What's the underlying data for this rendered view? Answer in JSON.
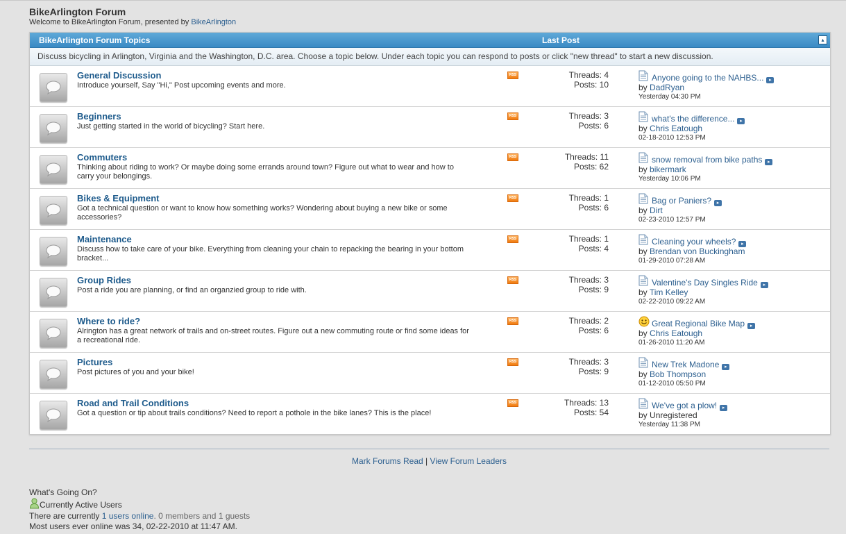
{
  "header": {
    "title": "BikeArlington Forum",
    "welcome_prefix": "Welcome to BikeArlington Forum, presented by",
    "welcome_link": "BikeArlington"
  },
  "table": {
    "col_topics": "BikeArlington Forum Topics",
    "col_last_post": "Last Post",
    "collapse_symbol": "▴",
    "description": "Discuss bicycling in Arlington, Virginia and the Washington, D.C. area. Choose a topic below. Under each topic you can respond to posts or click \"new thread\" to start a new discussion."
  },
  "forums": [
    {
      "title": "General Discussion",
      "desc": "Introduce yourself, Say \"Hi,\" Post upcoming events and more.",
      "threads": "Threads: 4",
      "posts": "Posts: 10",
      "lp_title": "Anyone going to the NAHBS...",
      "lp_user": "DadRyan",
      "lp_user_link": true,
      "lp_date": "Yesterday 04:30 PM",
      "lp_icon": "doc"
    },
    {
      "title": "Beginners",
      "desc": "Just getting started in the world of bicycling? Start here.",
      "threads": "Threads: 3",
      "posts": "Posts: 6",
      "lp_title": "what's the difference...",
      "lp_user": "Chris Eatough",
      "lp_user_link": true,
      "lp_date": "02-18-2010 12:53 PM",
      "lp_icon": "doc"
    },
    {
      "title": "Commuters",
      "desc": "Thinking about riding to work? Or maybe doing some errands around town? Figure out what to wear and how to carry your belongings.",
      "threads": "Threads: 11",
      "posts": "Posts: 62",
      "lp_title": "snow removal from bike paths",
      "lp_user": "bikermark",
      "lp_user_link": true,
      "lp_date": "Yesterday 10:06 PM",
      "lp_icon": "doc"
    },
    {
      "title": "Bikes & Equipment",
      "desc": "Got a technical question or want to know how something works? Wondering about buying a new bike or some accessories?",
      "threads": "Threads: 1",
      "posts": "Posts: 6",
      "lp_title": "Bag or Paniers?",
      "lp_user": "Dirt",
      "lp_user_link": true,
      "lp_date": "02-23-2010 12:57 PM",
      "lp_icon": "doc"
    },
    {
      "title": "Maintenance",
      "desc": "Discuss how to take care of your bike. Everything from cleaning your chain to repacking the bearing in your bottom bracket...",
      "threads": "Threads: 1",
      "posts": "Posts: 4",
      "lp_title": "Cleaning your wheels?",
      "lp_user": "Brendan von Buckingham",
      "lp_user_link": true,
      "lp_date": "01-29-2010 07:28 AM",
      "lp_icon": "doc"
    },
    {
      "title": "Group Rides",
      "desc": "Post a ride you are planning, or find an organzied group to ride with.",
      "threads": "Threads: 3",
      "posts": "Posts: 9",
      "lp_title": "Valentine's Day Singles Ride",
      "lp_user": "Tim Kelley",
      "lp_user_link": true,
      "lp_date": "02-22-2010 09:22 AM",
      "lp_icon": "doc"
    },
    {
      "title": "Where to ride?",
      "desc": "Alrington has a great network of trails and on-street routes. Figure out a new commuting route or find some ideas for a recreational ride.",
      "threads": "Threads: 2",
      "posts": "Posts: 6",
      "lp_title": "Great Regional Bike Map",
      "lp_user": "Chris Eatough",
      "lp_user_link": true,
      "lp_date": "01-26-2010 11:20 AM",
      "lp_icon": "smile"
    },
    {
      "title": "Pictures",
      "desc": "Post pictures of you and your bike!",
      "threads": "Threads: 3",
      "posts": "Posts: 9",
      "lp_title": "New Trek Madone",
      "lp_user": "Bob Thompson",
      "lp_user_link": true,
      "lp_date": "01-12-2010 05:50 PM",
      "lp_icon": "doc"
    },
    {
      "title": "Road and Trail Conditions",
      "desc": "Got a question or tip about trails conditions? Need to report a pothole in the bike lanes? This is the place!",
      "threads": "Threads: 13",
      "posts": "Posts: 54",
      "lp_title": "We've got a plow!",
      "lp_user": "Unregistered",
      "lp_user_link": false,
      "lp_date": "Yesterday 11:38 PM",
      "lp_icon": "doc"
    }
  ],
  "labels": {
    "by": "by",
    "rss": "RSS",
    "goto_symbol": "▸"
  },
  "footer": {
    "mark_read": "Mark Forums Read",
    "divider": "|",
    "leaders": "View Forum Leaders"
  },
  "whats_going_on": {
    "title": "What's Going On?",
    "active_users": "Currently Active Users",
    "online_prefix": "There are currently",
    "online_link": "1 users online",
    "online_suffix": ". 0 members and 1 guests",
    "most_ever": "Most users ever online was 34, 02-22-2010 at 11:47 AM."
  },
  "colors": {
    "header_bar": "#3a8ac4",
    "link": "#2c5f8f",
    "forum_title": "#1e5b8c",
    "rss": "#f07b10"
  }
}
